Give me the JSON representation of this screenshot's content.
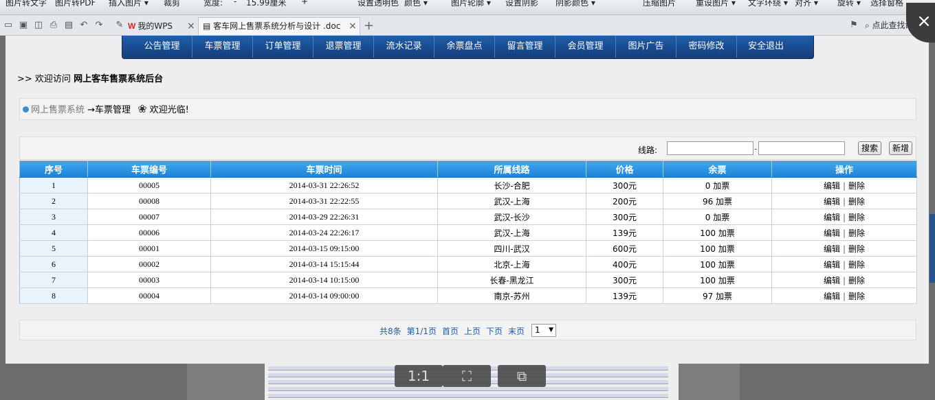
{
  "top_strip": {
    "items": [
      "图片转文字",
      "图片转PDF",
      "插入图片 ▾",
      "裁剪",
      "宽度:",
      "-",
      "15.99厘米",
      "+",
      "设置透明色",
      "颜色 ▾",
      "图片轮廓 ▾",
      "设置阴影",
      "阴影颜色 ▾",
      "压缩图片",
      "重设图片 ▾",
      "文字环绕 ▾",
      "对齐 ▾",
      "旋转 ▾",
      "选择窗格"
    ]
  },
  "doc_bar": {
    "wps_tab": "我的WPS",
    "doc_tab": "客车网上售票系统分析与设计 .doc",
    "close_glyph": "×",
    "add_glyph": "+",
    "search_text": "点此查找命"
  },
  "viewer": {
    "zoom_label": "1:1",
    "close_glyph": "×"
  },
  "nav": {
    "items": [
      "公告管理",
      "车票管理",
      "订单管理",
      "退票管理",
      "流水记录",
      "余票盘点",
      "留言管理",
      "会员管理",
      "图片广告",
      "密码修改",
      "安全退出"
    ]
  },
  "welcome": {
    "prefix": ">> 欢迎访问",
    "site": "网上客车售票系统后台"
  },
  "breadcrumb": {
    "system": "网上售票系统",
    "arrow_page": "→车票管理",
    "greeting": "欢迎光临!"
  },
  "search": {
    "label": "线路:",
    "from_value": "",
    "to_value": "",
    "dash": "-",
    "search_button": "搜索",
    "add_button": "新增"
  },
  "table": {
    "headers": [
      "序号",
      "车票编号",
      "车票时间",
      "所属线路",
      "价格",
      "余票",
      "操作"
    ],
    "add_ticket_label": "加票",
    "edit_label": "编辑",
    "delete_label": "删除",
    "op_separator": "|",
    "rows": [
      {
        "seq": "1",
        "code": "00005",
        "time": "2014-03-31 22:26:52",
        "route": "长沙-合肥",
        "price": "300元",
        "remain": "0"
      },
      {
        "seq": "2",
        "code": "00008",
        "time": "2014-03-31 22:22:55",
        "route": "武汉-上海",
        "price": "200元",
        "remain": "96"
      },
      {
        "seq": "3",
        "code": "00007",
        "time": "2014-03-29 22:26:31",
        "route": "武汉-长沙",
        "price": "300元",
        "remain": "0"
      },
      {
        "seq": "4",
        "code": "00006",
        "time": "2014-03-24 22:26:17",
        "route": "武汉-上海",
        "price": "139元",
        "remain": "100"
      },
      {
        "seq": "5",
        "code": "00001",
        "time": "2014-03-15 09:15:00",
        "route": "四川-武汉",
        "price": "600元",
        "remain": "100"
      },
      {
        "seq": "6",
        "code": "00002",
        "time": "2014-03-14 15:15:44",
        "route": "北京-上海",
        "price": "400元",
        "remain": "100"
      },
      {
        "seq": "7",
        "code": "00003",
        "time": "2014-03-14 10:15:00",
        "route": "长春-黑龙江",
        "price": "300元",
        "remain": "100"
      },
      {
        "seq": "8",
        "code": "00004",
        "time": "2014-03-14 09:00:00",
        "route": "南京-苏州",
        "price": "139元",
        "remain": "97"
      }
    ]
  },
  "pager": {
    "total": "共8条",
    "page_info": "第1/1页",
    "first": "首页",
    "prev": "上页",
    "next": "下页",
    "last": "末页",
    "page_select": "1"
  },
  "colors": {
    "nav_blue": "#19498c",
    "header_blue": "#1f82d6",
    "link_blue": "#1f5da8"
  }
}
